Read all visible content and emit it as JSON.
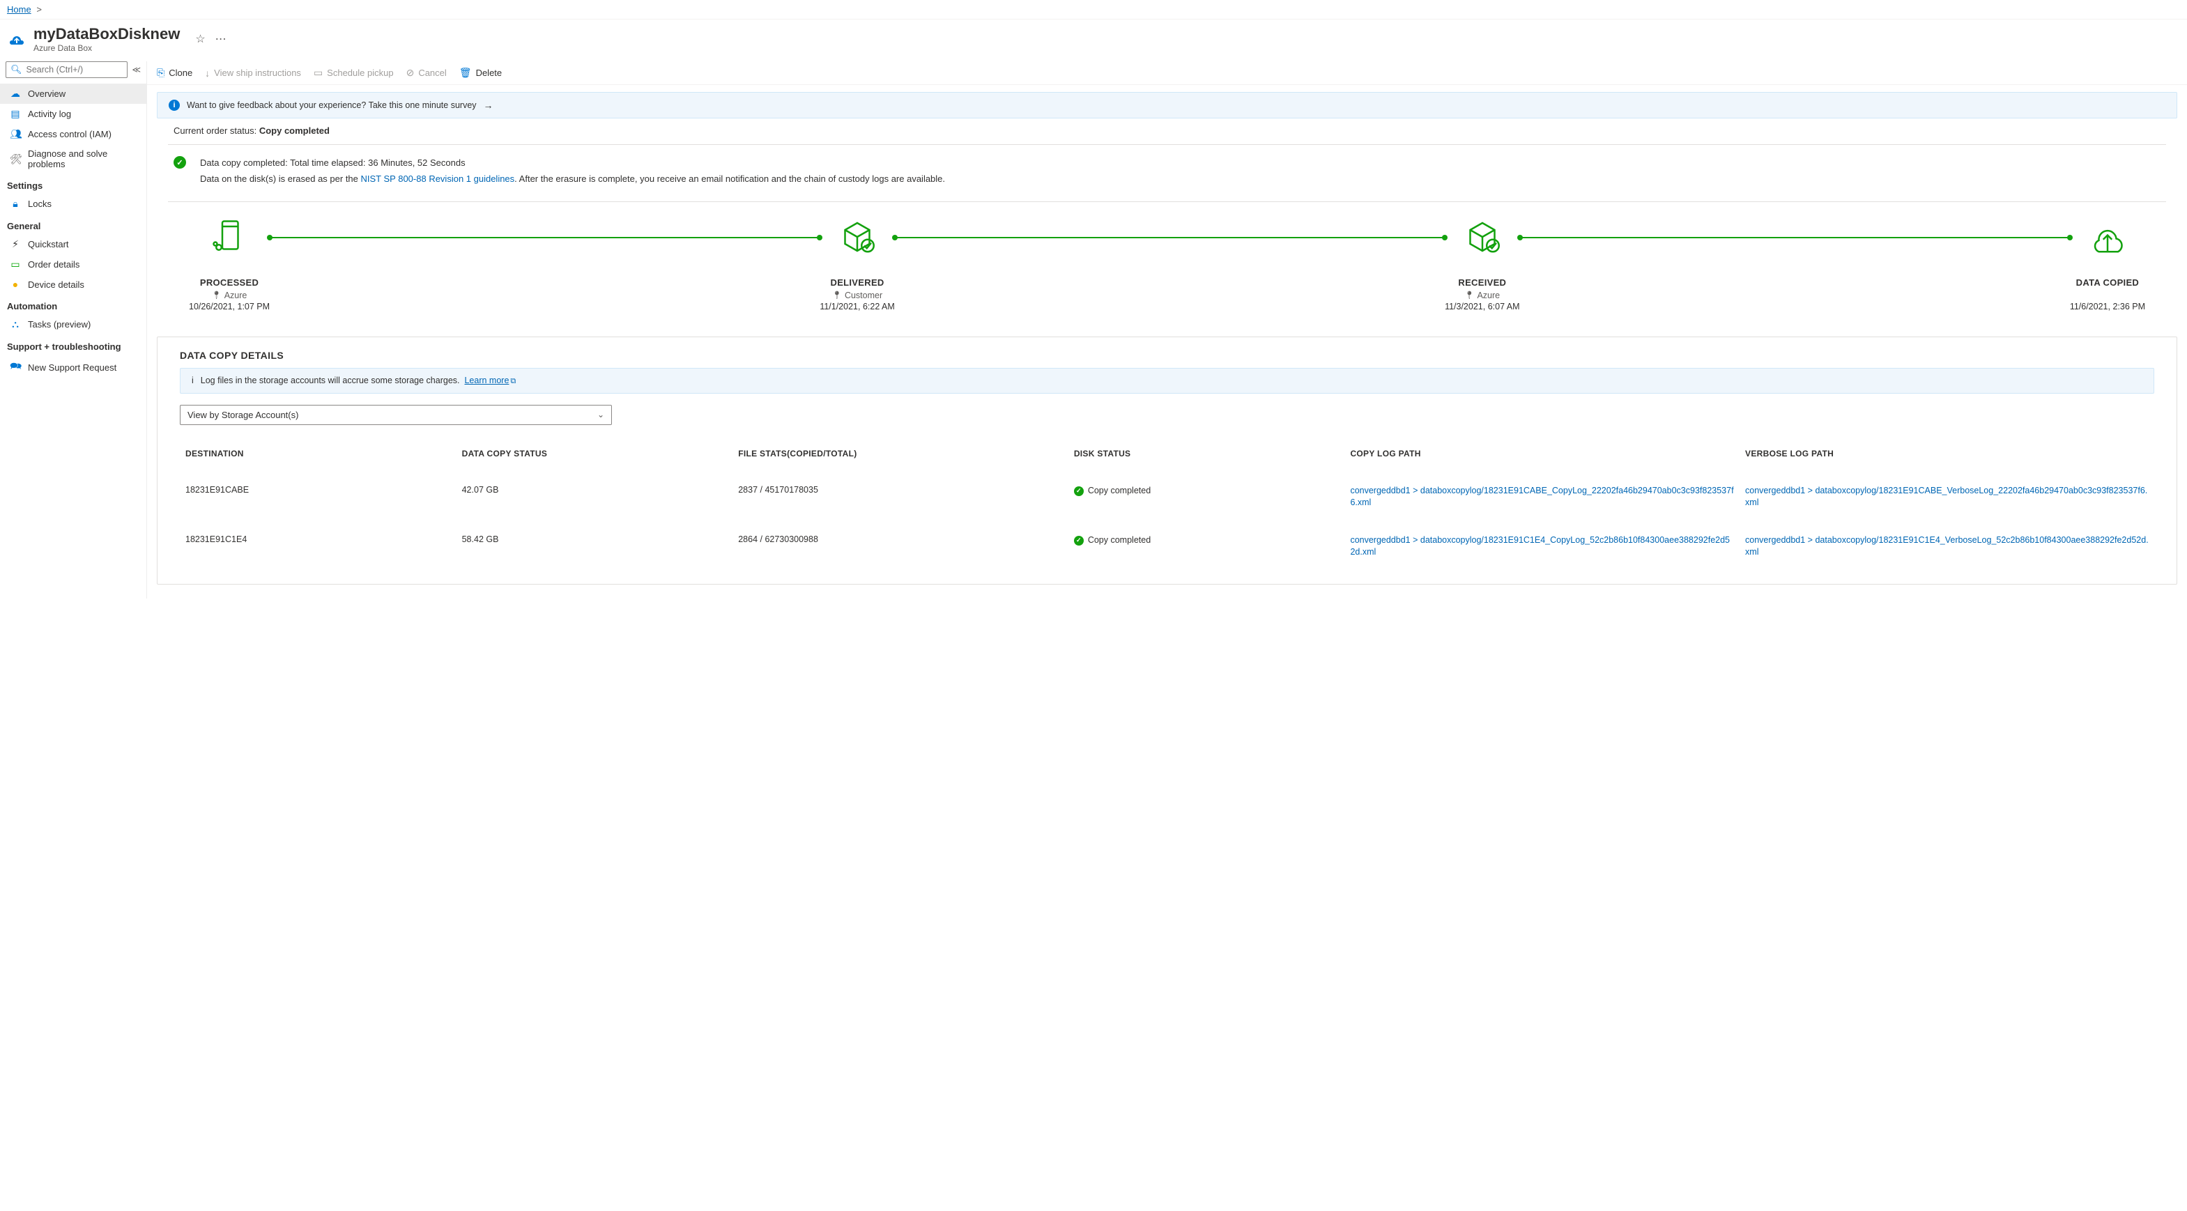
{
  "breadcrumb": {
    "home": "Home"
  },
  "header": {
    "title": "myDataBoxDisknew",
    "subtitle": "Azure Data Box"
  },
  "search": {
    "placeholder": "Search (Ctrl+/)"
  },
  "nav": {
    "overview": "Overview",
    "activity": "Activity log",
    "access": "Access control (IAM)",
    "diagnose": "Diagnose and solve problems",
    "settings_header": "Settings",
    "locks": "Locks",
    "general_header": "General",
    "quickstart": "Quickstart",
    "order": "Order details",
    "device": "Device details",
    "automation_header": "Automation",
    "tasks": "Tasks (preview)",
    "support_header": "Support + troubleshooting",
    "support": "New Support Request"
  },
  "toolbar": {
    "clone": "Clone",
    "ship": "View ship instructions",
    "schedule": "Schedule pickup",
    "cancel": "Cancel",
    "delete": "Delete"
  },
  "feedback": {
    "text": "Want to give feedback about your experience? Take this one minute survey"
  },
  "status": {
    "label": "Current order status: ",
    "value": "Copy completed"
  },
  "copyinfo": {
    "line1": "Data copy completed: Total time elapsed: 36 Minutes, 52 Seconds",
    "line2a": "Data on the disk(s) is erased as per the ",
    "line2link": "NIST SP 800-88 Revision 1 guidelines",
    "line2b": ". After the erasure is complete, you receive an email notification and the chain of custody logs are available."
  },
  "stages": [
    {
      "title": "PROCESSED",
      "sub": "Azure",
      "date": "10/26/2021, 1:07 PM"
    },
    {
      "title": "DELIVERED",
      "sub": "Customer",
      "date": "11/1/2021, 6:22 AM"
    },
    {
      "title": "RECEIVED",
      "sub": "Azure",
      "date": "11/3/2021, 6:07 AM"
    },
    {
      "title": "DATA COPIED",
      "sub": "",
      "date": "11/6/2021, 2:36 PM"
    }
  ],
  "details": {
    "title": "DATA COPY DETAILS",
    "info": "Log files in the storage accounts will accrue some storage charges.",
    "learn": "Learn more",
    "selector": "View by Storage Account(s)",
    "columns": {
      "dest": "DESTINATION",
      "status": "DATA COPY STATUS",
      "files": "FILE STATS(COPIED/TOTAL)",
      "disk": "DISK STATUS",
      "copylog": "COPY LOG PATH",
      "verbose": "VERBOSE LOG PATH"
    },
    "rows": [
      {
        "dest": "18231E91CABE",
        "status": "42.07 GB",
        "files": "2837 / 45170178035",
        "disk": "Copy completed",
        "copylog": "convergeddbd1 > databoxcopylog/18231E91CABE_CopyLog_22202fa46b29470ab0c3c93f823537f6.xml",
        "verbose": "convergeddbd1 > databoxcopylog/18231E91CABE_VerboseLog_22202fa46b29470ab0c3c93f823537f6.xml"
      },
      {
        "dest": "18231E91C1E4",
        "status": "58.42 GB",
        "files": "2864 / 62730300988",
        "disk": "Copy completed",
        "copylog": "convergeddbd1 > databoxcopylog/18231E91C1E4_CopyLog_52c2b86b10f84300aee388292fe2d52d.xml",
        "verbose": "convergeddbd1 > databoxcopylog/18231E91C1E4_VerboseLog_52c2b86b10f84300aee388292fe2d52d.xml"
      }
    ]
  }
}
